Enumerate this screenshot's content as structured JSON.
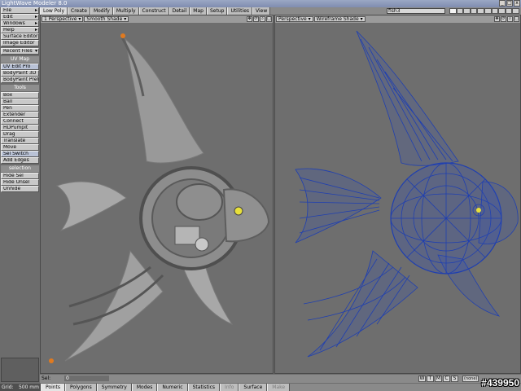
{
  "window": {
    "title": "LightWave Modeler 8.0",
    "controls": [
      "_",
      "□",
      "x"
    ]
  },
  "left_panel": {
    "menus": [
      "File",
      "Edit",
      "Windows",
      "Help"
    ],
    "top_buttons": [
      "Surface Editor",
      "Image Editor"
    ],
    "recent": "Recent Files",
    "uvmap_header": "UV Map",
    "uvmap_items": [
      "UV Edit Pro",
      "BodyPaint 3D",
      "BodyPaint Prefs"
    ],
    "tools_header": "Tools",
    "tools_items": [
      "Box",
      "Ball",
      "Pen",
      "Extender",
      "Connect",
      "HDPumpIt",
      "Drag",
      "Translate",
      "Move",
      "Sel Switch",
      "Add Edges"
    ],
    "selection_header": "selection",
    "selection_items": [
      "Hide Sel",
      "Hide Unsel",
      "Unhide"
    ]
  },
  "tabs": [
    "Low Poly",
    "Create",
    "Modify",
    "Multiply",
    "Construct",
    "Detail",
    "Map",
    "Setup",
    "Utilities",
    "View"
  ],
  "active_tab": "Low Poly",
  "object": "fish3",
  "viewports": {
    "left": {
      "index": "1",
      "projection": "Perspective",
      "shading": "Smooth Shade"
    },
    "right": {
      "projection": "Perspective",
      "shading": "Wireframe Shade"
    }
  },
  "info": {
    "sel_label": "Sel:",
    "sel_value": "0",
    "axes": [
      "W",
      "T",
      "M",
      "C",
      "S"
    ],
    "unit": "(none)"
  },
  "grid": {
    "label": "Grid:",
    "value": "500 mm"
  },
  "modes": [
    "Points",
    "Polygons",
    "Symmetry",
    "Modes",
    "Numeric",
    "Statistics",
    "Info",
    "Surface",
    "Make"
  ],
  "active_mode": "Points",
  "watermark": "#439950",
  "colors": {
    "wire": "#1f3fb0",
    "shade": "#9c9c9c",
    "background": "#6e6e6e",
    "eye": "#e8e03a"
  }
}
